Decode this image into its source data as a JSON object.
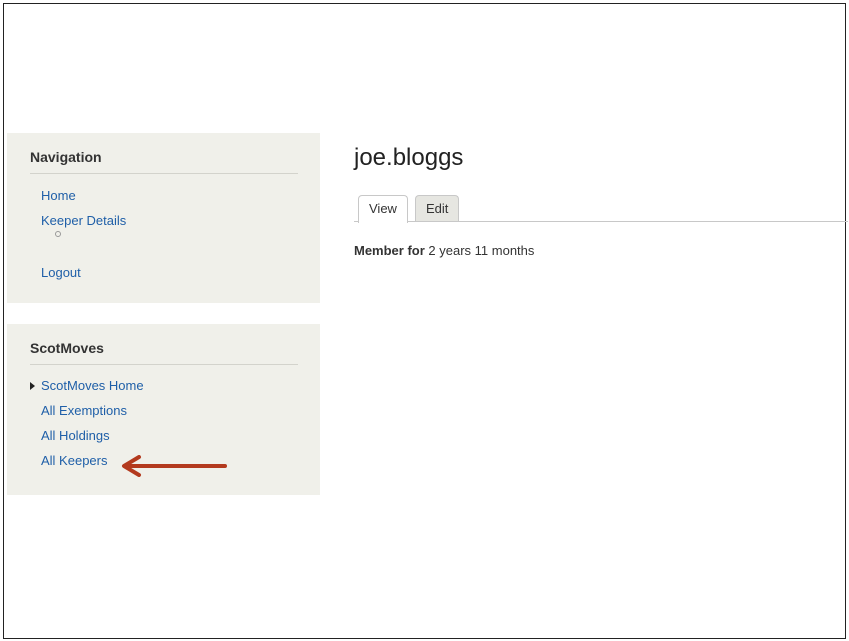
{
  "navigation": {
    "title": "Navigation",
    "items": [
      {
        "label": "Home"
      },
      {
        "label": "Keeper Details"
      },
      {
        "label": "Logout"
      }
    ]
  },
  "scotmoves": {
    "title": "ScotMoves",
    "items": [
      {
        "label": "ScotMoves Home",
        "expandable": true
      },
      {
        "label": "All Exemptions"
      },
      {
        "label": "All Holdings"
      },
      {
        "label": "All Keepers"
      }
    ]
  },
  "annotation": {
    "arrow_color": "#b33a1e",
    "points_to": "All Keepers"
  },
  "user": {
    "name": "joe.bloggs",
    "tabs": [
      {
        "label": "View",
        "active": true
      },
      {
        "label": "Edit",
        "active": false
      }
    ],
    "member_label": "Member for",
    "member_value": "2 years 11 months"
  },
  "colors": {
    "link": "#1f5fa8",
    "sidebar_bg": "#f0f0ea"
  }
}
